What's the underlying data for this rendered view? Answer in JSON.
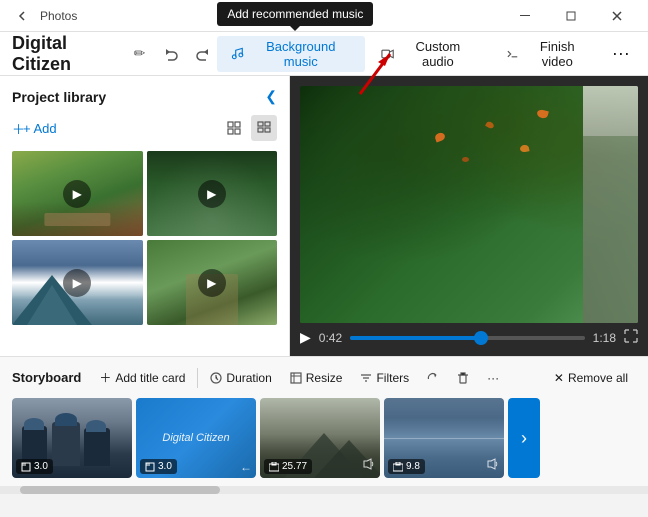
{
  "titlebar": {
    "appname": "Photos",
    "back_label": "‹",
    "minimize": "─",
    "maximize": "□",
    "close": "✕"
  },
  "main_toolbar": {
    "project_title": "Digital Citizen",
    "edit_icon": "✏",
    "undo_icon": "↩",
    "redo_icon": "↪"
  },
  "music_toolbar": {
    "tooltip": "Add recommended music",
    "background_music_label": "Background music",
    "custom_audio_label": "Custom audio",
    "finish_video_label": "Finish video",
    "more_icon": "···"
  },
  "left_panel": {
    "title": "Project library",
    "add_label": "+ Add",
    "collapse_icon": "❮"
  },
  "playback": {
    "play_icon": "▶",
    "time_current": "0:42",
    "time_end": "1:18",
    "fullscreen_icon": "⛶"
  },
  "storyboard": {
    "title": "Storyboard",
    "add_title_card": "Add title card",
    "duration": "Duration",
    "resize": "Resize",
    "filters": "Filters",
    "rotate_icon": "↺",
    "delete_icon": "🗑",
    "more_icon": "···",
    "remove_all": "Remove all",
    "clips": [
      {
        "badge": "3.0",
        "has_image_icon": true
      },
      {
        "badge": "3.0",
        "has_image_icon": true,
        "text": "Digital Citizen"
      },
      {
        "badge": "25.77",
        "has_audio": true
      },
      {
        "badge": "9.8",
        "has_audio": true
      }
    ]
  }
}
